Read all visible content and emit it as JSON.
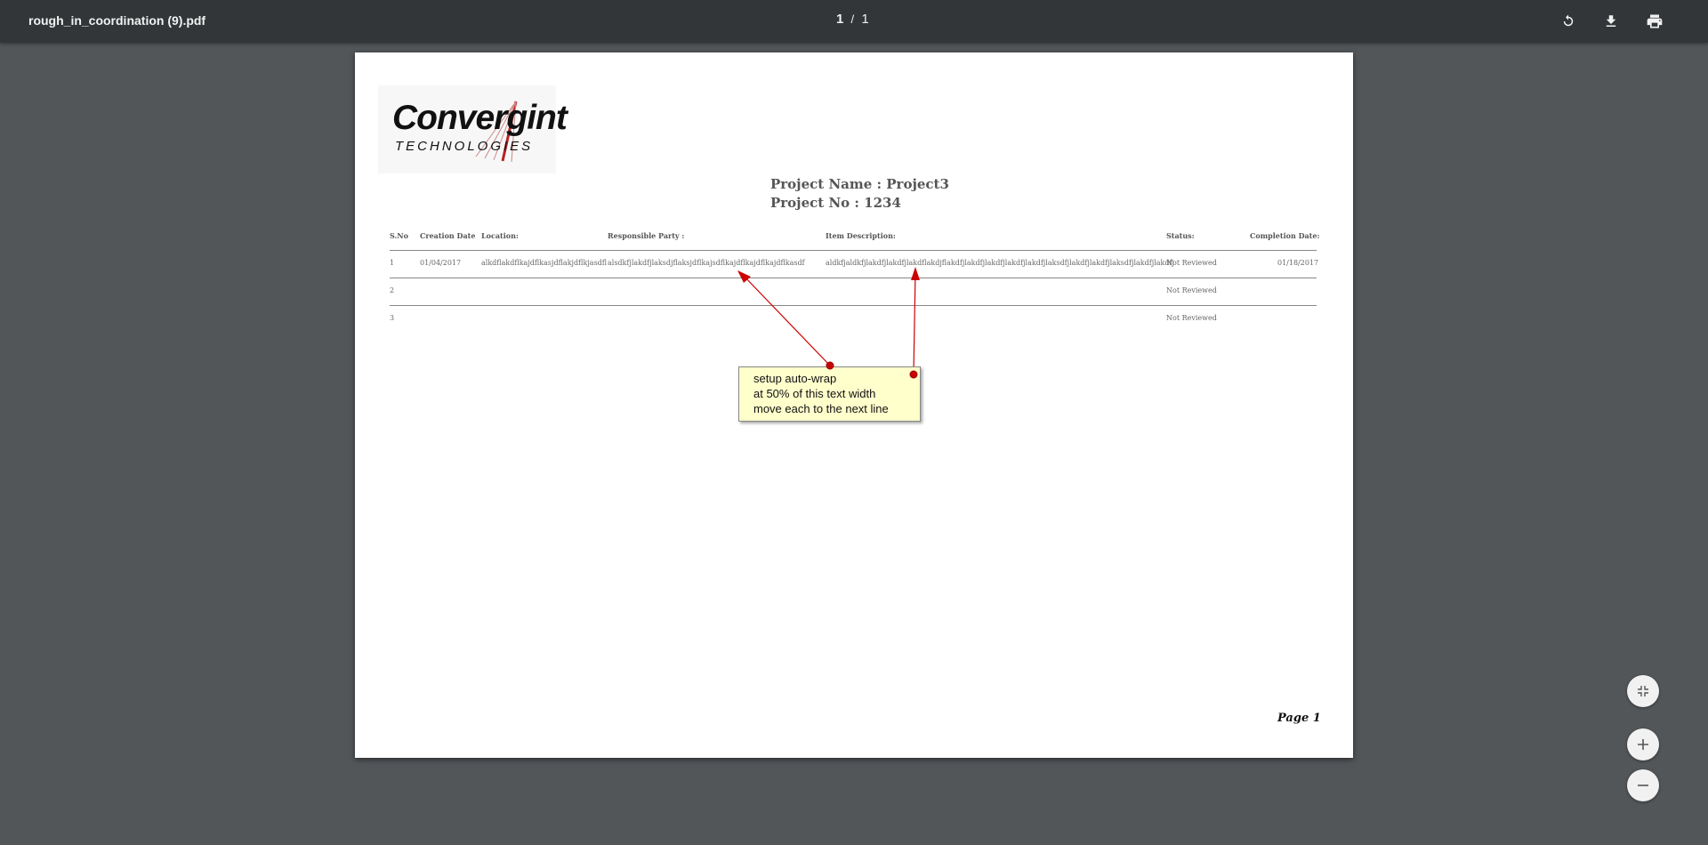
{
  "toolbar": {
    "file_name": "rough_in_coordination (9).pdf",
    "current_page": "1",
    "separator": "/",
    "total_pages": "1",
    "icons": [
      "rotate-icon",
      "download-icon",
      "print-icon"
    ]
  },
  "document": {
    "logo": {
      "name": "Convergint",
      "sub": "TECHNOLOGIES"
    },
    "project_name": "Project Name : Project3",
    "project_no": "Project No : 1234",
    "table": {
      "headers": [
        "S.No",
        "Creation Date",
        "Location:",
        "Responsible Party :",
        "Item Description:",
        "Status:",
        "Completion Date:"
      ],
      "rows": [
        [
          "1",
          "01/04/2017",
          "alkdflakdflkajdflkasjdflakjdflkjasdfl",
          "alsdkfjlakdfjlaksdjflaksjdflkajsdflkajdflkajdflkajdflkasdf",
          "aldkfjaldkfjlakdfjlakdfjlakdflakdjflakdfjlakdfjlakdfjlakdfjlakdfjlaksdfjlakdfjlakdfjlaksdfjlakdfjlakdfj",
          "Not Reviewed",
          "01/18/2017"
        ],
        [
          "2",
          "",
          "",
          "",
          "",
          "Not Reviewed",
          ""
        ],
        [
          "3",
          "",
          "",
          "",
          "",
          "Not Reviewed",
          ""
        ]
      ]
    },
    "footer": "Page 1",
    "annotation": {
      "lines": [
        "setup auto-wrap",
        "at 50% of this text width",
        "move each to the next line"
      ],
      "color": "#cc0000"
    }
  },
  "zoom_controls": [
    "fit-page-icon",
    "zoom-in-icon",
    "zoom-out-icon"
  ]
}
